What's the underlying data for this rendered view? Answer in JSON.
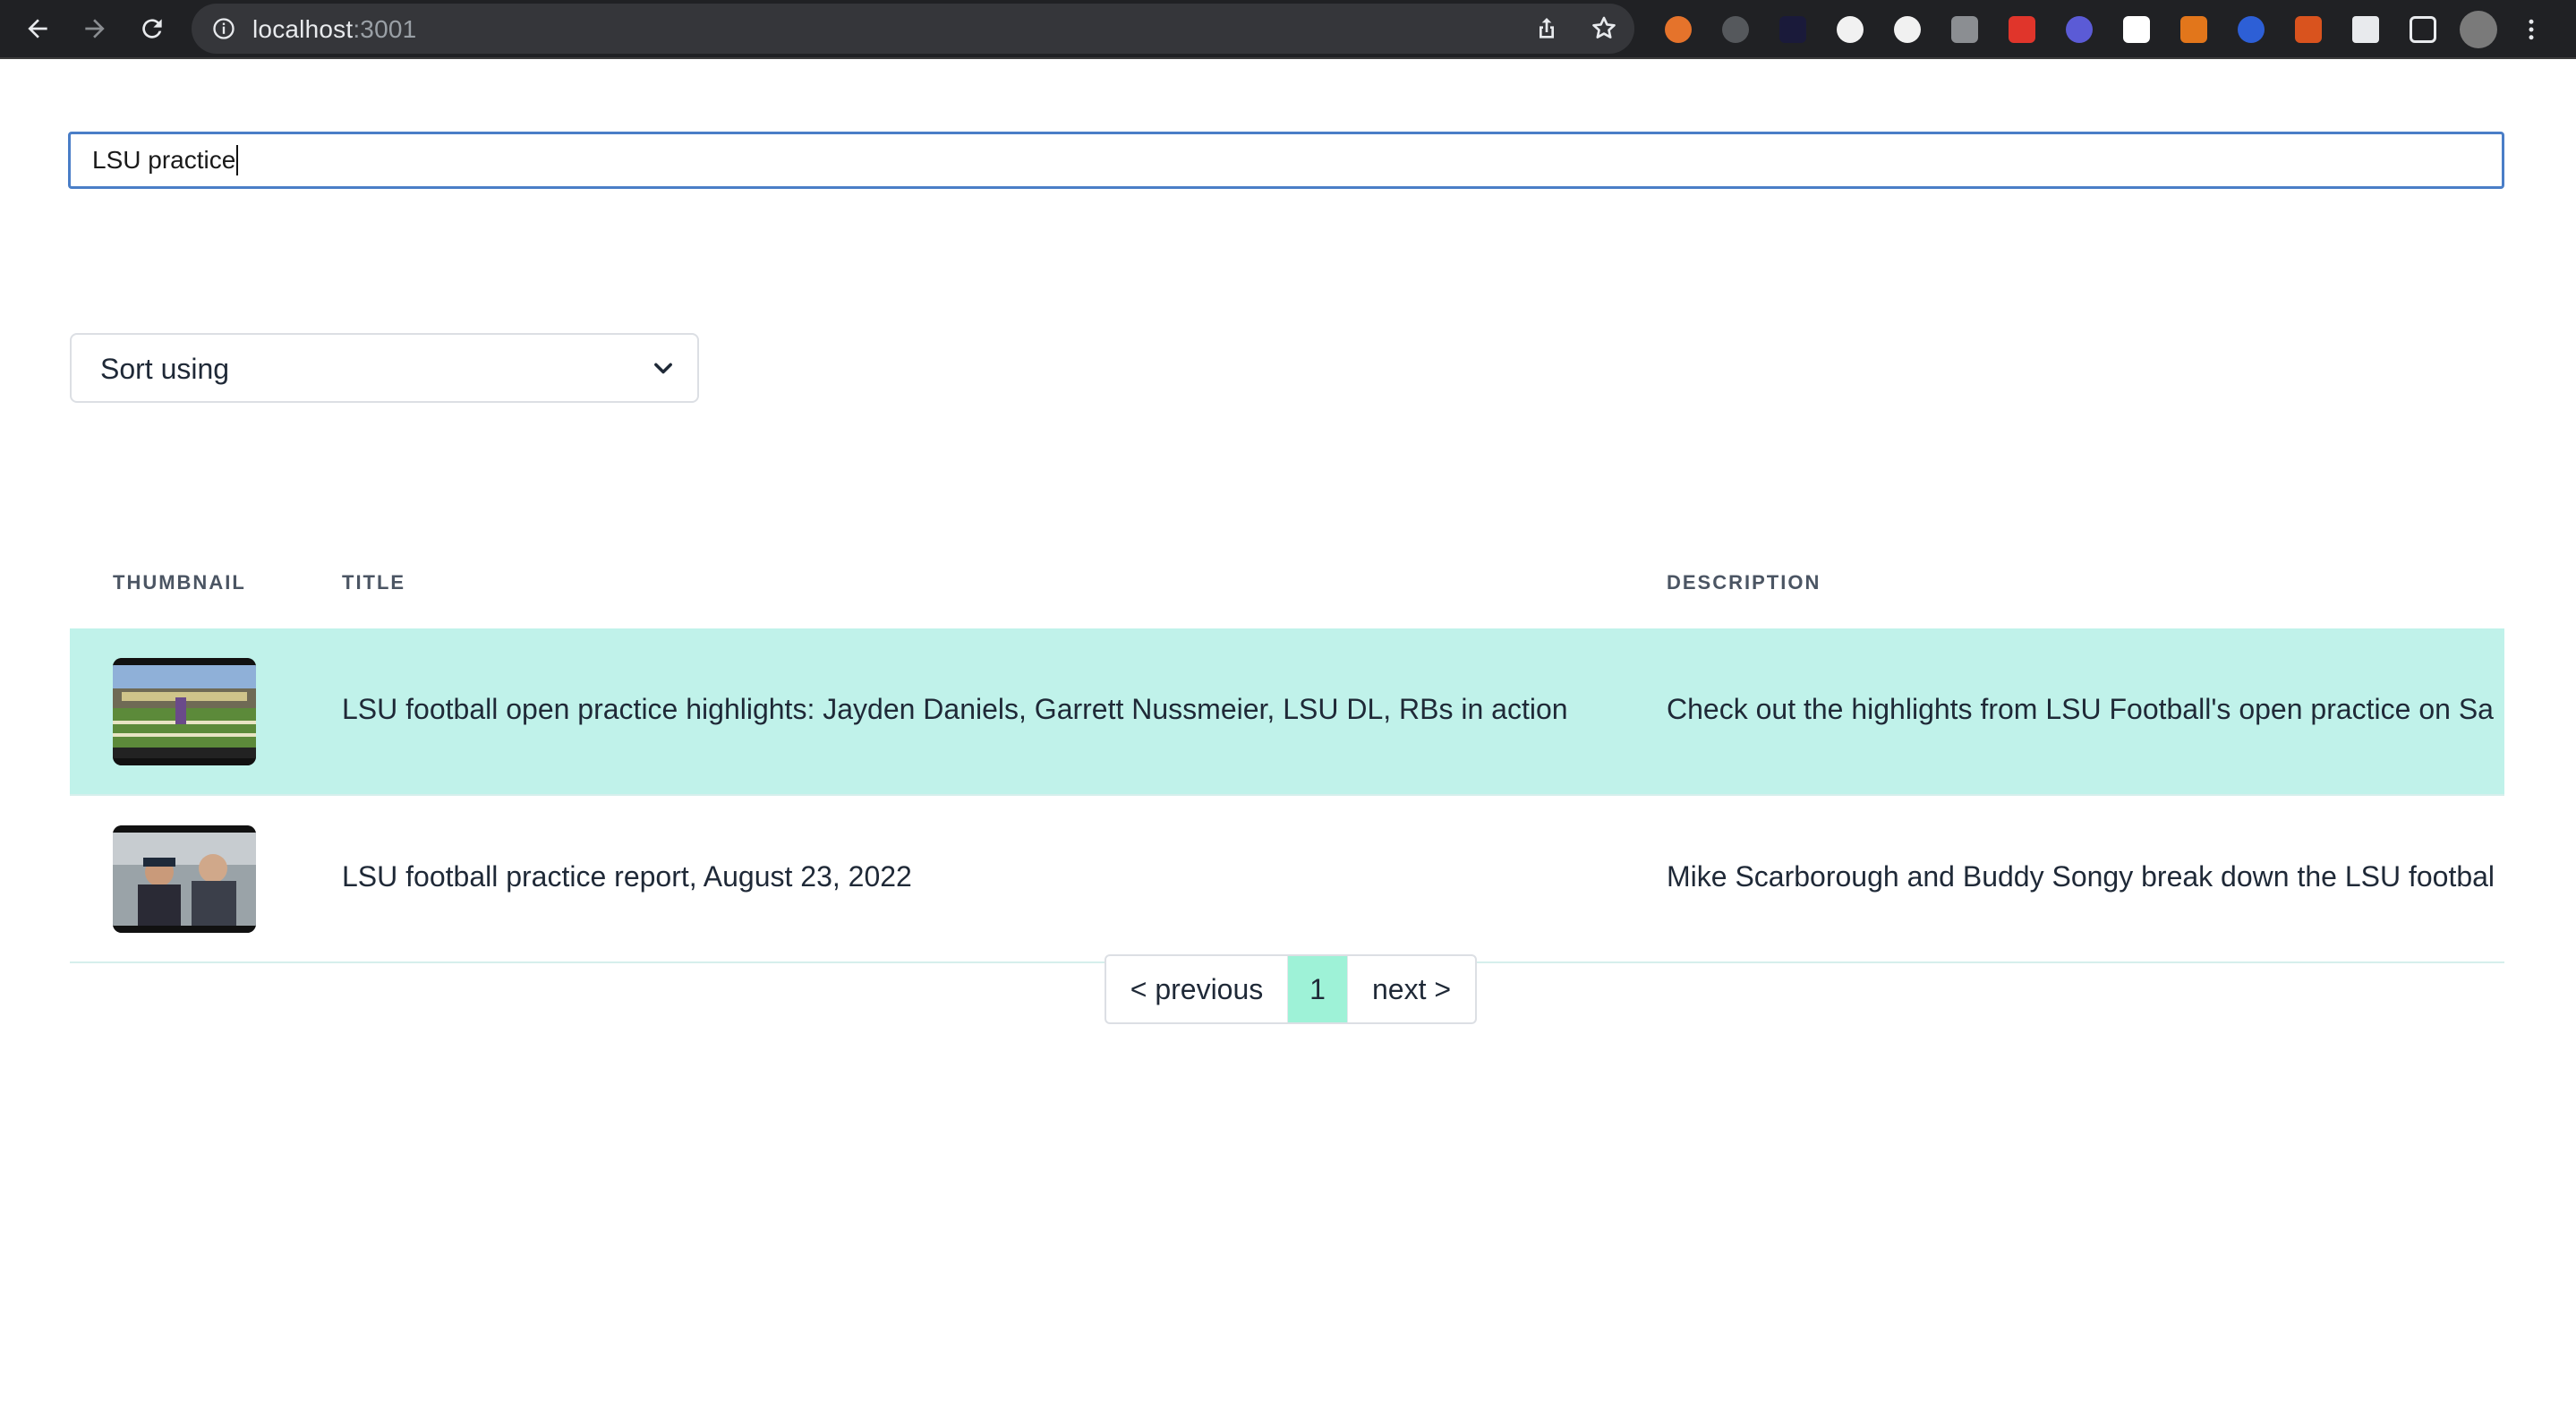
{
  "browser": {
    "url_host": "localhost",
    "url_port": ":3001"
  },
  "search": {
    "value": "LSU practice"
  },
  "sort": {
    "label": "Sort using"
  },
  "table": {
    "headers": {
      "thumbnail": "THUMBNAIL",
      "title": "TITLE",
      "description": "DESCRIPTION"
    },
    "rows": [
      {
        "title": "LSU football open practice highlights: Jayden Daniels, Garrett Nussmeier, LSU DL, RBs in action",
        "description": "Check out the highlights from LSU Football's open practice on Sa",
        "highlighted": true
      },
      {
        "title": "LSU football practice report, August 23, 2022",
        "description": "Mike Scarborough and Buddy Songy break down the LSU footbal",
        "highlighted": false
      }
    ]
  },
  "pagination": {
    "previous": "< previous",
    "current": "1",
    "next": "next >"
  },
  "colors": {
    "highlight_row": "#c0f2ea",
    "current_page": "#9ef2d7",
    "focus_border": "#4a7ec7"
  }
}
